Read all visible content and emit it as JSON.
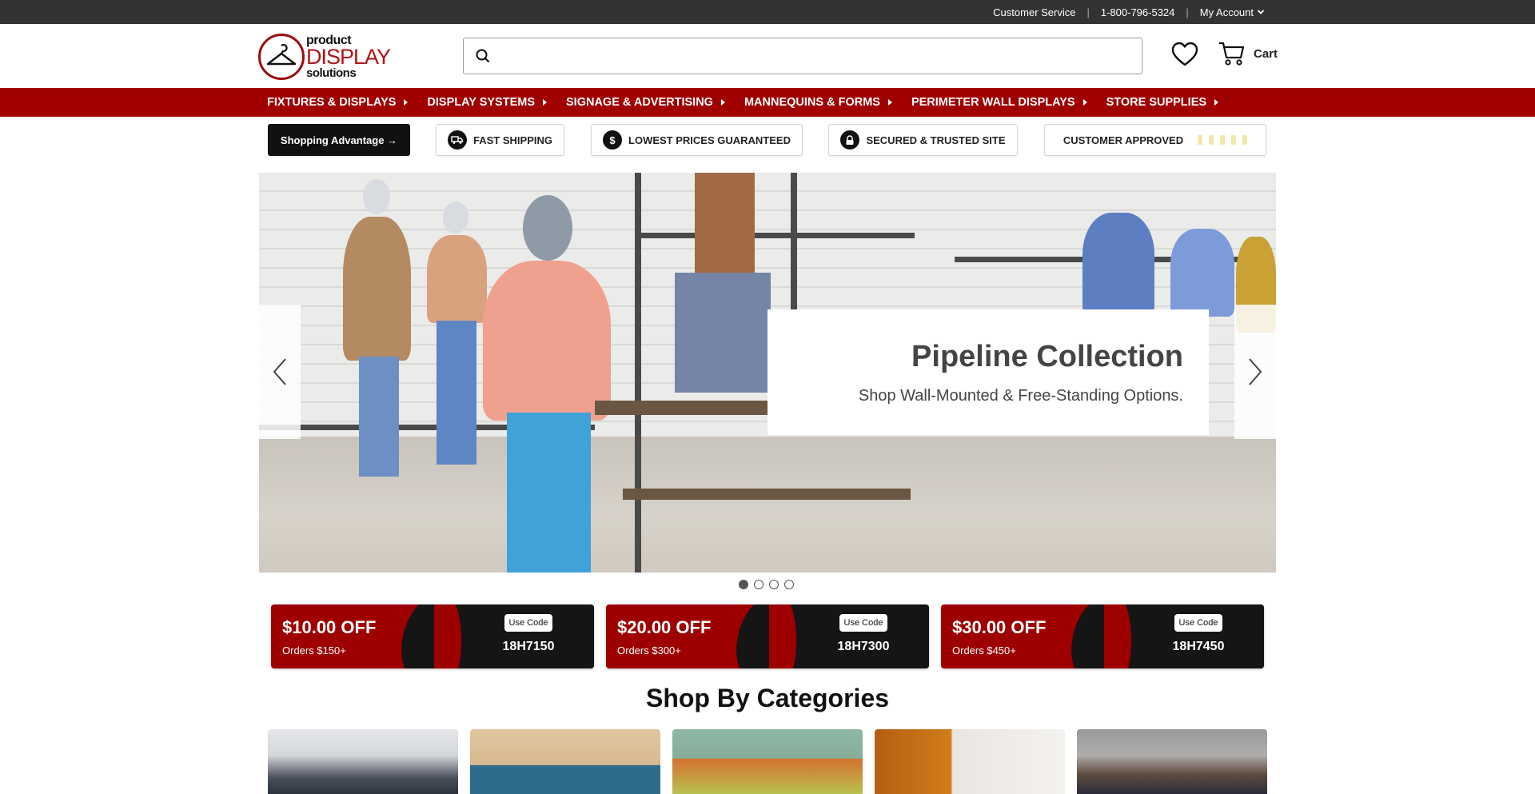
{
  "topbar": {
    "customer_service": "Customer Service",
    "separator": "|",
    "phone": "1-800-796-5324",
    "my_account": "My Account"
  },
  "header": {
    "logo": {
      "line1": "product",
      "line2": "DISPLAY",
      "line3": "solutions"
    },
    "search": {
      "value": "",
      "placeholder": ""
    },
    "cart_label": "Cart"
  },
  "nav": {
    "items": [
      {
        "label": "FIXTURES & DISPLAYS"
      },
      {
        "label": "DISPLAY SYSTEMS"
      },
      {
        "label": "SIGNAGE & ADVERTISING"
      },
      {
        "label": "MANNEQUINS & FORMS"
      },
      {
        "label": "PERIMETER WALL DISPLAYS"
      },
      {
        "label": "STORE SUPPLIES"
      }
    ]
  },
  "advantages": {
    "shopping_advantage": "Shopping Advantage →",
    "fast_shipping": "FAST SHIPPING",
    "lowest_prices": "LOWEST PRICES GUARANTEED",
    "lowest_prices_icon_glyph": "$",
    "secured": "SECURED & TRUSTED SITE",
    "approved": "CUSTOMER APPROVED"
  },
  "hero": {
    "title": "Pipeline Collection",
    "subtitle": "Shop Wall-Mounted & Free-Standing Options.",
    "active_slide": 1,
    "slide_count": 4
  },
  "coupons": [
    {
      "amount": "$10.00 OFF",
      "condition": "Orders $150+",
      "use_label": "Use Code",
      "code": "18H7150"
    },
    {
      "amount": "$20.00 OFF",
      "condition": "Orders $300+",
      "use_label": "Use Code",
      "code": "18H7300"
    },
    {
      "amount": "$30.00 OFF",
      "condition": "Orders $450+",
      "use_label": "Use Code",
      "code": "18H7450"
    }
  ],
  "categories": {
    "title": "Shop By Categories"
  },
  "colors": {
    "nav_red": "#a00000",
    "topbar": "#333333",
    "coupon_red": "#9e0000",
    "coupon_dark": "#151515"
  }
}
